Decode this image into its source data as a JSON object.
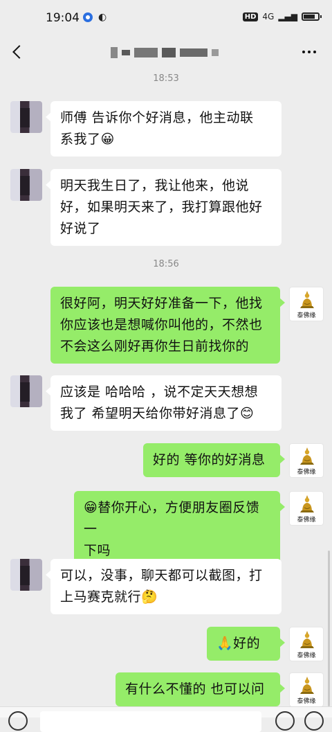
{
  "status_bar": {
    "time": "19:04",
    "hd_badge": "HD",
    "signal": "4G"
  },
  "nav": {
    "title": "",
    "back_icon": "chevron-left-icon",
    "more_icon": "more-dots-icon"
  },
  "messages": [
    {
      "kind": "timestamp",
      "text": "18:53"
    },
    {
      "kind": "in",
      "lines": [
        "师傅 告诉你个好消息，他主动联",
        "系我了😀"
      ]
    },
    {
      "kind": "in",
      "lines": [
        "明天我生日了，我让他来，他说",
        "好，如果明天来了，我打算跟他好",
        "好说了"
      ]
    },
    {
      "kind": "timestamp",
      "text": "18:56"
    },
    {
      "kind": "out",
      "lines": [
        "很好阿，明天好好准备一下，他找",
        "你应该也是想喊你叫他的，不然也",
        "不会这么刚好再你生日前找你的"
      ]
    },
    {
      "kind": "in",
      "lines": [
        "应该是 哈哈哈 ，说不定天天想想",
        "我了  希望明天给你带好消息了😊"
      ]
    },
    {
      "kind": "out",
      "lines": [
        "好的 等你的好消息"
      ]
    },
    {
      "kind": "out",
      "lines": [
        "😁替你开心，方便朋友圈反馈一",
        "下吗"
      ]
    },
    {
      "kind": "in",
      "lines": [
        "可以，没事，聊天都可以截图，打",
        "上马赛克就行🤔"
      ]
    },
    {
      "kind": "out",
      "lines": [
        "🙏好的"
      ]
    },
    {
      "kind": "out",
      "lines": [
        "有什么不懂的 也可以问"
      ]
    }
  ],
  "avatar_caption": "泰佛缘",
  "colors": {
    "background": "#ededed",
    "incoming_bubble": "#ffffff",
    "outgoing_bubble": "#95ec69",
    "timestamp_text": "#888888"
  }
}
